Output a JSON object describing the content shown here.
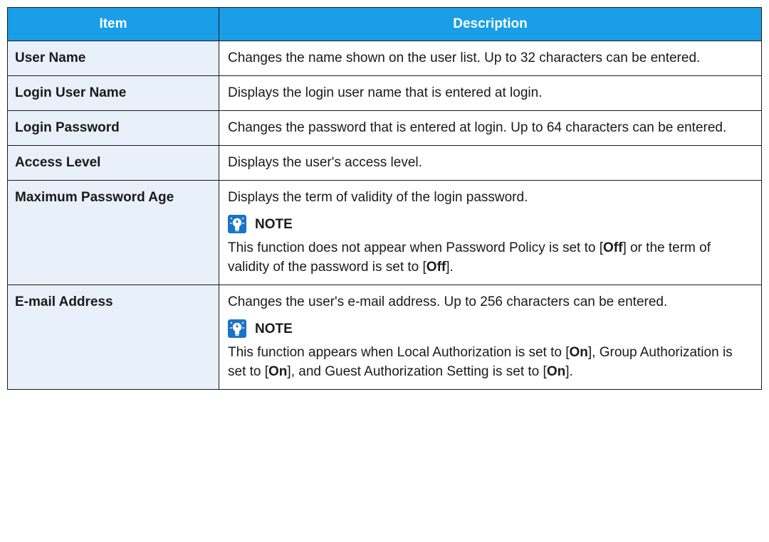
{
  "table": {
    "headers": {
      "item": "Item",
      "description": "Description"
    },
    "rows": [
      {
        "item": "User Name",
        "description": "Changes the name shown on the user list. Up to 32 characters can be entered."
      },
      {
        "item": "Login User Name",
        "description": "Displays the login user name that is entered at login."
      },
      {
        "item": "Login Password",
        "description": "Changes the password that is entered at login. Up to 64 characters can be entered."
      },
      {
        "item": "Access Level",
        "description": "Displays the user's access level."
      },
      {
        "item": "Maximum Password Age",
        "description": "Displays the term of validity of the login password.",
        "note": {
          "label": "NOTE",
          "icon": "note-lightbulb-icon",
          "parts": [
            "This function does not appear when Password Policy is set to [",
            "Off",
            "] or the term of validity of the password is set to [",
            "Off",
            "]."
          ]
        }
      },
      {
        "item": "E-mail Address",
        "description": "Changes the user's e-mail address. Up to 256 characters can be entered.",
        "note": {
          "label": "NOTE",
          "icon": "note-lightbulb-icon",
          "parts": [
            "This function appears when Local Authorization is set to [",
            "On",
            "], Group Authorization is set to [",
            "On",
            "], and Guest Authorization Setting is set to [",
            "On",
            "]."
          ]
        }
      }
    ]
  },
  "colors": {
    "header_bg": "#1a9ee8",
    "item_col_bg": "#e8f0fa",
    "icon_blue": "#1a73c8"
  }
}
